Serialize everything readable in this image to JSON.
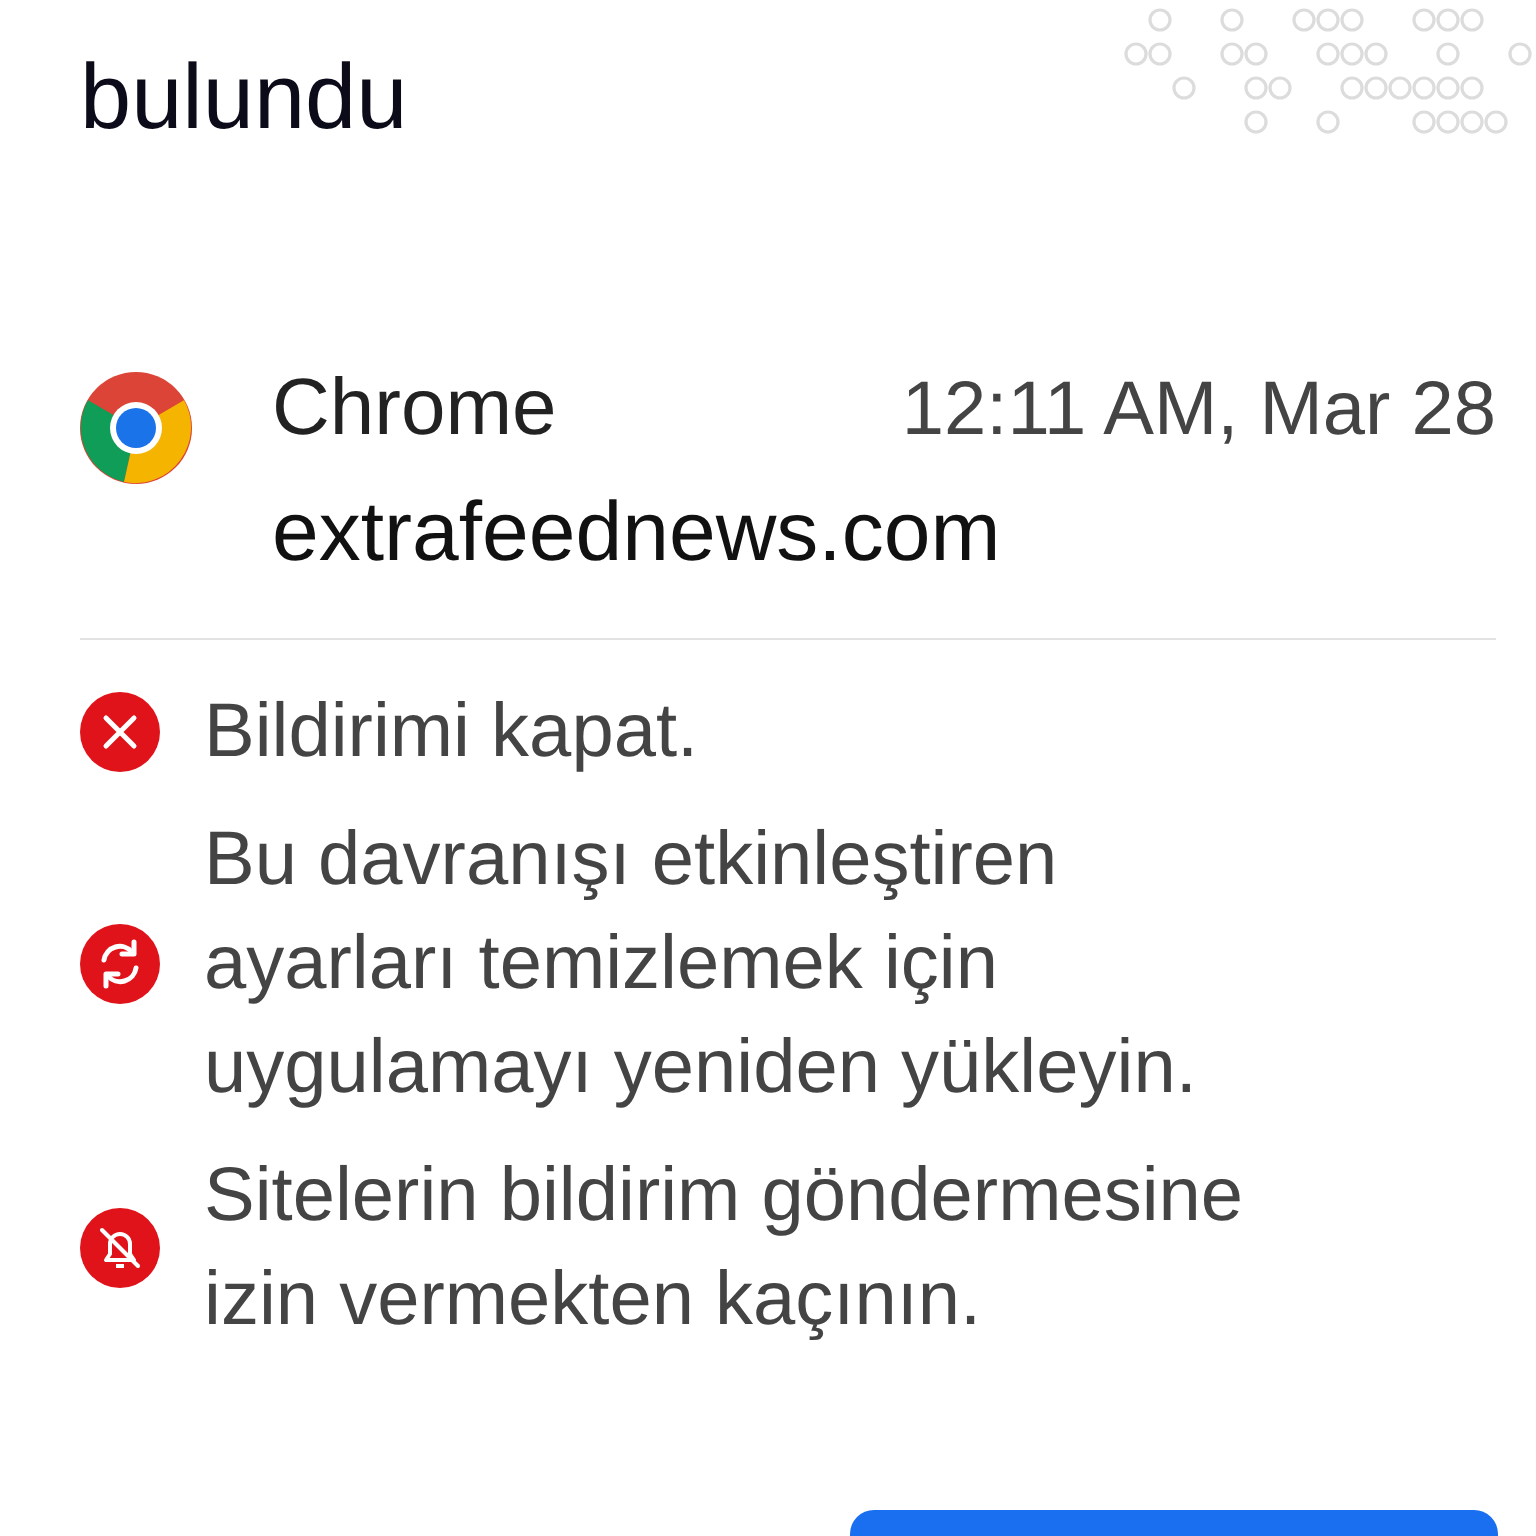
{
  "title": "bulundu",
  "notification": {
    "app": "Chrome",
    "time": "12:11 AM, Mar 28",
    "site": "extrafeednews.com"
  },
  "tips": [
    {
      "kind": "close",
      "text": "Bildirimi kapat."
    },
    {
      "kind": "reinstall",
      "text": "Bu davranışı etkinleştiren ayarları temizlemek için uygulamayı yeniden yükleyin."
    },
    {
      "kind": "mute",
      "text": "Sitelerin bildirim göndermesine izin vermekten kaçının."
    }
  ],
  "bottom_button": {
    "kind": "primary"
  }
}
